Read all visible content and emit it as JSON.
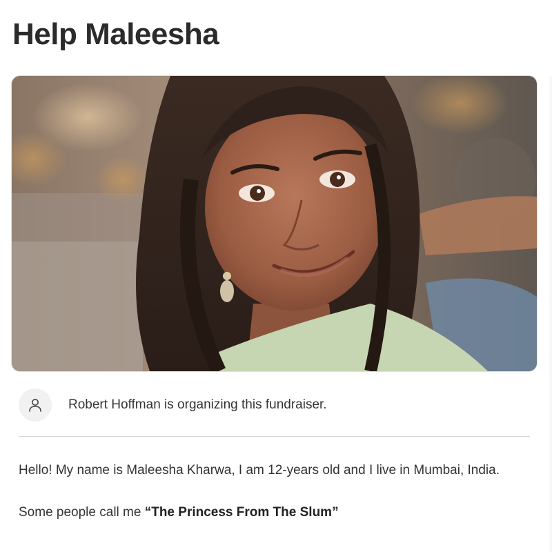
{
  "header": {
    "title": "Help Maleesha"
  },
  "hero": {
    "image": "fundraiser-photo"
  },
  "organizer": {
    "icon": "person-icon",
    "text": "Robert Hoffman is organizing this fundraiser."
  },
  "story": {
    "paragraph1": "Hello! My name is Maleesha Kharwa, I am 12-years old and I live in Mumbai, India.",
    "paragraph2_prefix": "Some people call me ",
    "paragraph2_bold": "“The Princess From The Slum”"
  }
}
